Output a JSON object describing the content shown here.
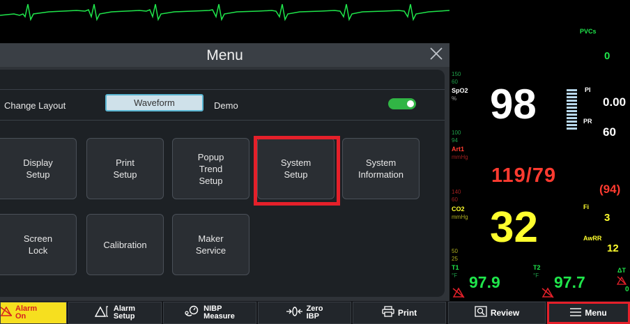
{
  "menu": {
    "title": "Menu",
    "change_layout_label": "Change Layout",
    "layout_value": "Waveform",
    "demo_label": "Demo",
    "demo_on": true,
    "tiles": [
      "Display\nSetup",
      "Print\nSetup",
      "Popup\nTrend\nSetup",
      "System\nSetup",
      "System\nInformation",
      "Screen\nLock",
      "Calibration",
      "Maker\nService"
    ]
  },
  "vitals": {
    "pvcs_label": "PVCs",
    "pvcs_value": "0",
    "spo2_scale_high": "150",
    "spo2_scale_low": "60",
    "spo2_label": "SpO2",
    "spo2_unit": "%",
    "spo2_value": "98",
    "pi_label": "PI",
    "pi_value": "0.00",
    "pr_label": "PR",
    "pr_value": "60",
    "art_scale_high": "100",
    "art_scale_low": "94",
    "art_label": "Art1",
    "art_unit": "mmHg",
    "art_value": "119/79",
    "art_mean": "(94)",
    "co2_scale_high": "140",
    "co2_scale_low": "60",
    "co2_label": "CO2",
    "co2_unit": "mmHg",
    "co2_value": "32",
    "fi_label": "Fi",
    "fi_value": "3",
    "awrr_label": "AwRR",
    "awrr_value": "12",
    "t_scale_high": "50",
    "t_scale_low": "25",
    "t1_label": "T1",
    "t1_unit": "°F",
    "t1_value": "97.9",
    "t2_label": "T2",
    "t2_unit": "°F",
    "t2_value": "97.7",
    "dt_label": "ΔT",
    "dt_value": "0"
  },
  "bottom": {
    "alarm_on_line1": "Alarm",
    "alarm_on_line2": "On",
    "alarm_setup_line1": "Alarm",
    "alarm_setup_line2": "Setup",
    "nibp_line1": "NIBP",
    "nibp_line2": "Measure",
    "zero_line1": "Zero",
    "zero_line2": "IBP",
    "print": "Print",
    "review": "Review",
    "menu": "Menu"
  },
  "colors": {
    "ecg": "#1fe64b",
    "spo2": "#ffffff",
    "art": "#ff3b30",
    "co2": "#ffff2e",
    "temp": "#1fe64b",
    "highlight": "#e5202a"
  }
}
